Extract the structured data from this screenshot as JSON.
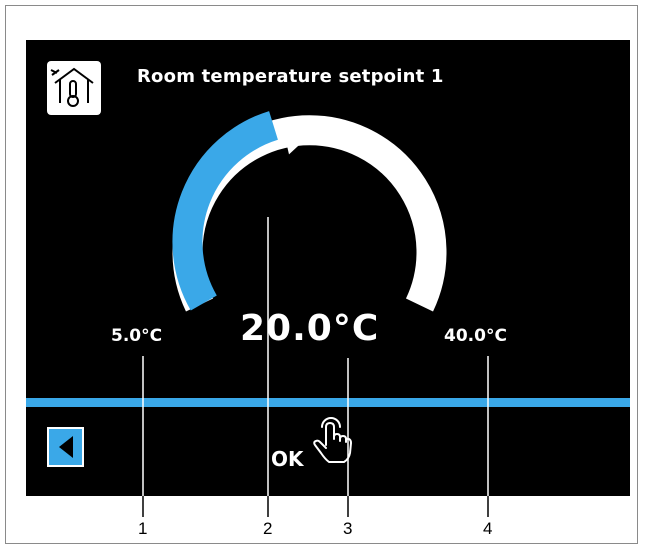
{
  "header": {
    "title": "Room temperature setpoint 1",
    "icon": "house-thermometer-icon"
  },
  "setpoint": {
    "min_label": "5.0°C",
    "max_label": "40.0°C",
    "value_label": "20.0°C",
    "min": 5.0,
    "max": 40.0,
    "value": 20.0
  },
  "footer": {
    "back_icon": "arrow-left-icon",
    "ok_label": "OK",
    "touch_icon": "hand-touch-icon"
  },
  "callouts": [
    "1",
    "2",
    "3",
    "4"
  ],
  "colors": {
    "accent": "#3aa8e8",
    "screen_bg": "#000000",
    "text": "#ffffff"
  }
}
